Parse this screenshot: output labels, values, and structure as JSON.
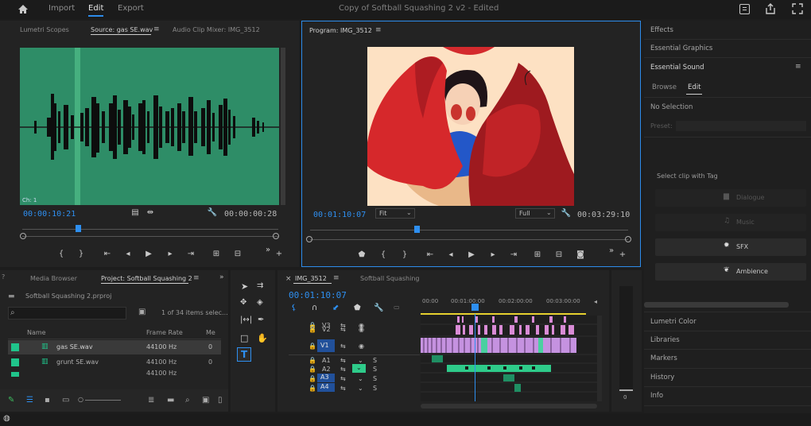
{
  "topbar": {
    "tabs": [
      "Import",
      "Edit",
      "Export"
    ],
    "doc_title": "Copy of Softball Squashing 2 v2 - Edited"
  },
  "source_panel": {
    "tabs": [
      "Lumetri Scopes",
      "Source: gas SE.wav",
      "Audio Clip Mixer: IMG_3512"
    ],
    "channel_label": "Ch: 1",
    "timecode_in": "00:00:10:21",
    "timecode_dur": "00:00:00:28",
    "colors": {
      "waveform_bg": "#2e8d67",
      "playhead_band": "#46b07f"
    }
  },
  "program_panel": {
    "tab": "Program: IMG_3512",
    "timecode": "00:01:10:07",
    "fit": "Fit",
    "quality": "Full",
    "duration": "00:03:29:10"
  },
  "right_panel": {
    "top_items": [
      "Effects",
      "Essential Graphics"
    ],
    "essential_sound": "Essential Sound",
    "subtabs": [
      "Browse",
      "Edit"
    ],
    "no_selection": "No Selection",
    "preset_label": "Preset:",
    "tag_prompt": "Select clip with Tag",
    "tags": [
      "Dialogue",
      "Music",
      "SFX",
      "Ambience"
    ],
    "bottom_items": [
      "Lumetri Color",
      "Libraries",
      "Markers",
      "History",
      "Info"
    ]
  },
  "project_panel": {
    "tabs": [
      "Media Browser",
      "Project: Softball Squashing 2"
    ],
    "project_file": "Softball Squashing 2.prproj",
    "item_count": "1 of 34 items selec...",
    "columns": [
      "Name",
      "Frame Rate",
      "Me"
    ],
    "rows": [
      {
        "name": "gas SE.wav",
        "rate": "44100 Hz",
        "extra": "0"
      },
      {
        "name": "grunt SE.wav",
        "rate": "44100 Hz",
        "extra": "0"
      },
      {
        "name": "",
        "rate": "44100 Hz",
        "extra": ""
      }
    ]
  },
  "timeline_panel": {
    "tabs": [
      "IMG_3512",
      "Softball Squashing"
    ],
    "timecode": "00:01:10:07",
    "ruler": [
      "00:00",
      "00:01:00:00",
      "00:02:00:00",
      "00:03:00:00"
    ],
    "tracks": [
      "V3",
      "V2",
      "V1",
      "A1",
      "A2",
      "A3",
      "A4"
    ]
  },
  "audio_meter": {
    "zero_label": "0"
  }
}
